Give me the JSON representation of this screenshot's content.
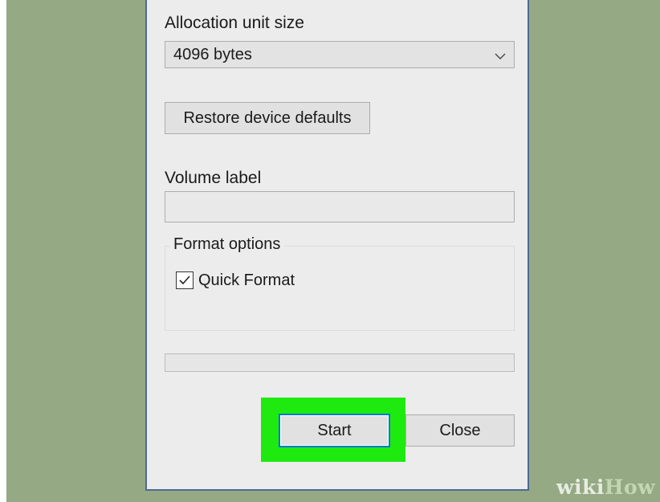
{
  "dialog": {
    "allocation": {
      "label": "Allocation unit size",
      "selected": "4096 bytes"
    },
    "restore_button_label": "Restore device defaults",
    "volume": {
      "label": "Volume label",
      "value": ""
    },
    "format_options": {
      "title": "Format options",
      "quick_format_label": "Quick Format",
      "quick_format_checked": true
    },
    "progress": 0,
    "buttons": {
      "start_label": "Start",
      "close_label": "Close"
    }
  },
  "highlight": {
    "color": "#1eea0f"
  },
  "watermark": {
    "part1": "wiki",
    "part2": "How"
  },
  "colors": {
    "background": "#94a984",
    "dialog_border": "#4e6a93",
    "focus_border": "#0078d7"
  }
}
